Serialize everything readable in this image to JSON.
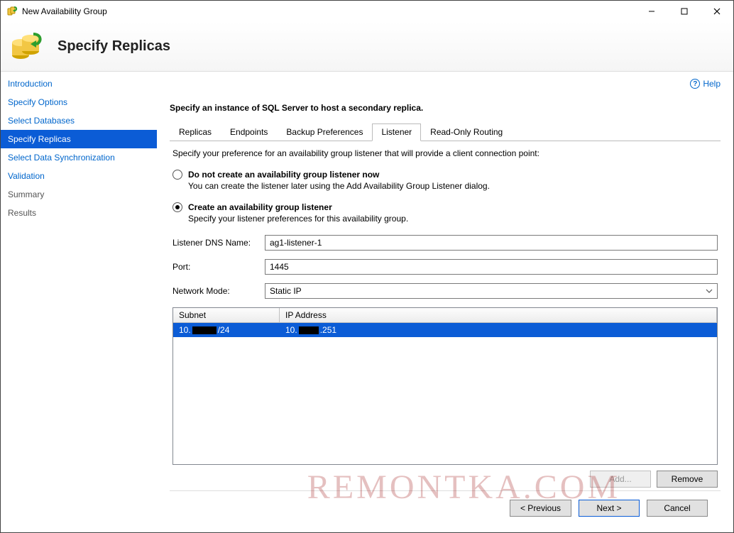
{
  "window": {
    "title": "New Availability Group"
  },
  "header": {
    "page_title": "Specify Replicas"
  },
  "help": {
    "label": "Help"
  },
  "sidebar": {
    "items": [
      {
        "label": "Introduction",
        "state": "link"
      },
      {
        "label": "Specify Options",
        "state": "link"
      },
      {
        "label": "Select Databases",
        "state": "link"
      },
      {
        "label": "Specify Replicas",
        "state": "active"
      },
      {
        "label": "Select Data Synchronization",
        "state": "link"
      },
      {
        "label": "Validation",
        "state": "link"
      },
      {
        "label": "Summary",
        "state": "disabled"
      },
      {
        "label": "Results",
        "state": "disabled"
      }
    ]
  },
  "main": {
    "instruction": "Specify an instance of SQL Server to host a secondary replica.",
    "tabs": [
      {
        "label": "Replicas"
      },
      {
        "label": "Endpoints"
      },
      {
        "label": "Backup Preferences"
      },
      {
        "label": "Listener"
      },
      {
        "label": "Read-Only Routing"
      }
    ],
    "active_tab": 3,
    "listener": {
      "pref_desc": "Specify your preference for an availability group listener that will provide a client connection point:",
      "opt1_label": "Do not create an availability group listener now",
      "opt1_sub": "You can create the listener later using the Add Availability Group Listener dialog.",
      "opt2_label": "Create an availability group listener",
      "opt2_sub": "Specify your listener preferences for this availability group.",
      "selected": "opt2",
      "dns_label": "Listener DNS Name:",
      "dns_value": "ag1-listener-1",
      "port_label": "Port:",
      "port_value": "1445",
      "mode_label": "Network Mode:",
      "mode_value": "Static IP",
      "table": {
        "col_subnet": "Subnet",
        "col_ip": "IP Address",
        "rows": [
          {
            "subnet_prefix": "10.",
            "subnet_suffix": "/24",
            "ip_prefix": "10.",
            "ip_suffix": ".251"
          }
        ]
      },
      "add_label": "Add...",
      "remove_label": "Remove"
    }
  },
  "footer": {
    "prev": "< Previous",
    "next": "Next >",
    "cancel": "Cancel"
  },
  "watermark": "REMONTKA.COM"
}
